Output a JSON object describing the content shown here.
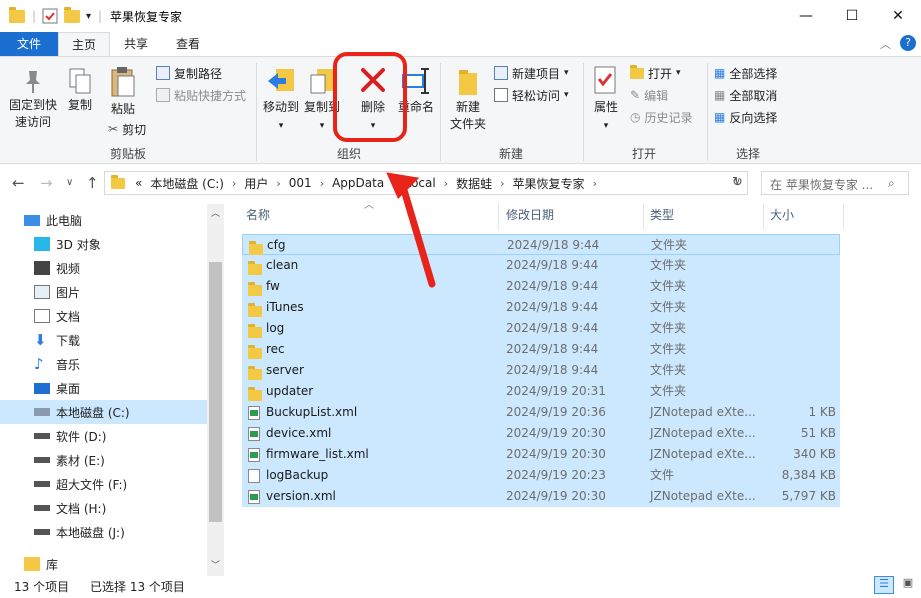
{
  "window": {
    "title": "苹果恢复专家",
    "controls": {
      "minimize": "—",
      "maximize": "☐",
      "close": "✕"
    }
  },
  "tabs": [
    {
      "label": "文件"
    },
    {
      "label": "主页"
    },
    {
      "label": "共享"
    },
    {
      "label": "查看"
    }
  ],
  "ribbon": {
    "clipboard": {
      "pin": "固定到快速访问",
      "pin_l1": "固定到快",
      "pin_l2": "速访问",
      "copy": "复制",
      "paste": "粘贴",
      "copy_path": "复制路径",
      "paste_shortcut": "粘贴快捷方式",
      "cut": "剪切",
      "group": "剪贴板"
    },
    "organize": {
      "move_to": "移动到",
      "copy_to": "复制到",
      "delete": "删除",
      "rename": "重命名",
      "group": "组织"
    },
    "new": {
      "new_folder_l1": "新建",
      "new_folder_l2": "文件夹",
      "new_item": "新建项目",
      "easy_access": "轻松访问",
      "group": "新建"
    },
    "open": {
      "properties": "属性",
      "open": "打开",
      "edit": "编辑",
      "history": "历史记录",
      "group": "打开"
    },
    "select": {
      "select_all": "全部选择",
      "select_none": "全部取消",
      "invert": "反向选择",
      "group": "选择"
    }
  },
  "address": {
    "overflow": "«",
    "path": [
      "本地磁盘 (C:)",
      "用户",
      "001",
      "AppData",
      "Local",
      "数据蛙",
      "苹果恢复专家"
    ],
    "search_placeholder": "在 苹果恢复专家 ..."
  },
  "nav_pane": {
    "items": [
      {
        "label": "此电脑",
        "icon": "computer-icon"
      },
      {
        "label": "3D 对象",
        "icon": "3d-objects-icon"
      },
      {
        "label": "视频",
        "icon": "video-icon"
      },
      {
        "label": "图片",
        "icon": "pictures-icon"
      },
      {
        "label": "文档",
        "icon": "documents-icon"
      },
      {
        "label": "下载",
        "icon": "download-icon"
      },
      {
        "label": "音乐",
        "icon": "music-icon"
      },
      {
        "label": "桌面",
        "icon": "desktop-icon"
      },
      {
        "label": "本地磁盘 (C:)",
        "icon": "drive-icon"
      },
      {
        "label": "软件 (D:)",
        "icon": "drive-icon"
      },
      {
        "label": "素材 (E:)",
        "icon": "drive-icon"
      },
      {
        "label": "超大文件 (F:)",
        "icon": "drive-icon"
      },
      {
        "label": "文档 (H:)",
        "icon": "drive-icon"
      },
      {
        "label": "本地磁盘 (J:)",
        "icon": "drive-icon"
      },
      {
        "label": "库",
        "icon": "library-icon"
      }
    ]
  },
  "file_list": {
    "columns": {
      "name": "名称",
      "date": "修改日期",
      "type": "类型",
      "size": "大小"
    },
    "rows": [
      {
        "name": "cfg",
        "date": "2024/9/18 9:44",
        "type": "文件夹",
        "size": "",
        "icon": "folder-icon"
      },
      {
        "name": "clean",
        "date": "2024/9/18 9:44",
        "type": "文件夹",
        "size": "",
        "icon": "folder-icon"
      },
      {
        "name": "fw",
        "date": "2024/9/18 9:44",
        "type": "文件夹",
        "size": "",
        "icon": "folder-icon"
      },
      {
        "name": "iTunes",
        "date": "2024/9/18 9:44",
        "type": "文件夹",
        "size": "",
        "icon": "folder-icon"
      },
      {
        "name": "log",
        "date": "2024/9/18 9:44",
        "type": "文件夹",
        "size": "",
        "icon": "folder-icon"
      },
      {
        "name": "rec",
        "date": "2024/9/18 9:44",
        "type": "文件夹",
        "size": "",
        "icon": "folder-icon"
      },
      {
        "name": "server",
        "date": "2024/9/18 9:44",
        "type": "文件夹",
        "size": "",
        "icon": "folder-icon"
      },
      {
        "name": "updater",
        "date": "2024/9/19 20:31",
        "type": "文件夹",
        "size": "",
        "icon": "folder-icon"
      },
      {
        "name": "BuckupList.xml",
        "date": "2024/9/19 20:36",
        "type": "JZNotepad eXte...",
        "size": "1 KB",
        "icon": "xml-file-icon"
      },
      {
        "name": "device.xml",
        "date": "2024/9/19 20:30",
        "type": "JZNotepad eXte...",
        "size": "51 KB",
        "icon": "xml-file-icon"
      },
      {
        "name": "firmware_list.xml",
        "date": "2024/9/19 20:30",
        "type": "JZNotepad eXte...",
        "size": "340 KB",
        "icon": "xml-file-icon"
      },
      {
        "name": "logBackup",
        "date": "2024/9/19 20:23",
        "type": "文件",
        "size": "8,384 KB",
        "icon": "file-icon"
      },
      {
        "name": "version.xml",
        "date": "2024/9/19 20:30",
        "type": "JZNotepad eXte...",
        "size": "5,797 KB",
        "icon": "xml-file-icon"
      }
    ]
  },
  "status": {
    "count": "13 个项目",
    "selected": "已选择 13 个项目"
  },
  "colors": {
    "accent": "#1b6fd0",
    "selection": "#cce8ff",
    "annotation": "#e8231a"
  }
}
